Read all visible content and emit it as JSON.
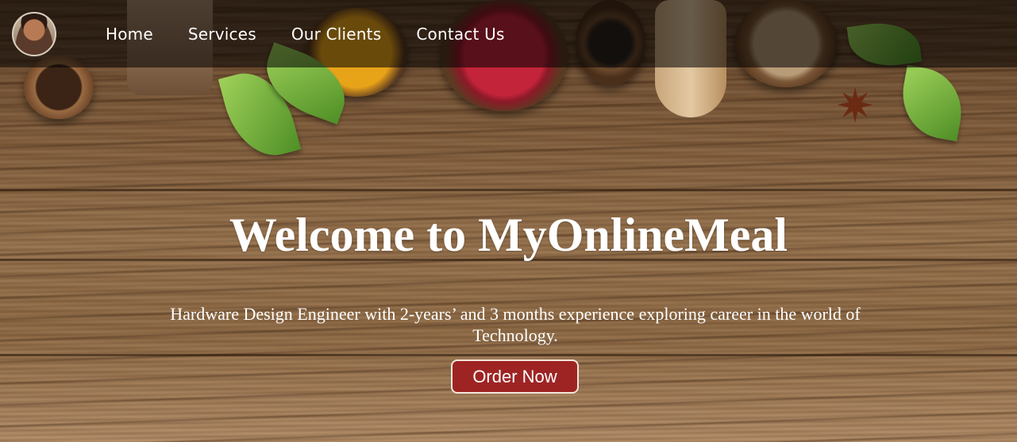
{
  "nav": {
    "avatar_icon": "profile-photo",
    "links": [
      {
        "label": "Home"
      },
      {
        "label": "Services"
      },
      {
        "label": "Our Clients"
      },
      {
        "label": "Contact Us"
      }
    ]
  },
  "hero": {
    "title": "Welcome to MyOnlineMeal",
    "subtitle": "Hardware Design Engineer with 2-years’ and 3 months experience exploring career in the world of Technology.",
    "cta_label": "Order Now"
  },
  "colors": {
    "nav_bg": "#000000",
    "cta_bg": "#9e2424",
    "text": "#ffffff"
  }
}
